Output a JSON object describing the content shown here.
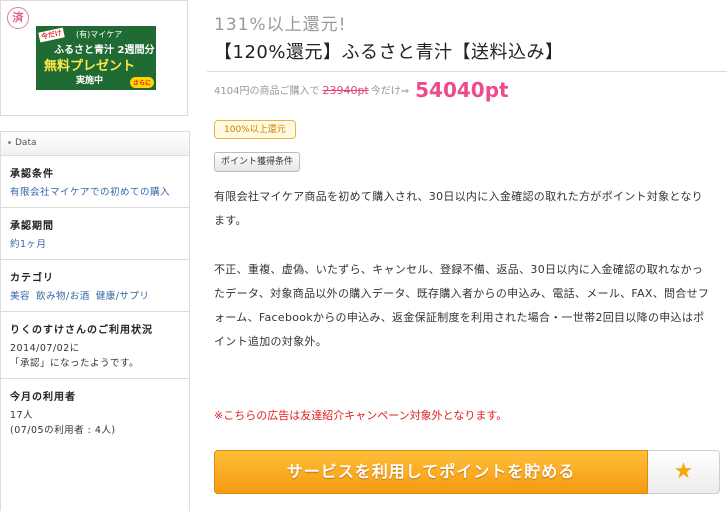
{
  "thumbnail": {
    "done_badge": "済",
    "banner": {
      "tag": "今だけ",
      "line1": "(有)マイケア",
      "line2": "ふるさと青汁 2週間分",
      "line3": "無料プレゼント",
      "line4": "実施中",
      "line5": "さらに"
    }
  },
  "data_panel": {
    "header": "Data",
    "approval_condition": {
      "title": "承認条件",
      "text": "有限会社マイケアでの初めての購入"
    },
    "approval_period": {
      "title": "承認期間",
      "text": "約1ヶ月"
    },
    "category": {
      "title": "カテゴリ",
      "links": [
        "美容",
        "飲み物/お酒",
        "健康/サプリ"
      ]
    },
    "usage_status": {
      "title": "りくのすけさんのご利用状況",
      "line1": "2014/07/02に",
      "line2": "「承認」になったようです。"
    },
    "today_users": {
      "title": "今月の利用者",
      "line1": "17人",
      "line2": "(07/05の利用者 : 4人)"
    }
  },
  "main": {
    "subtitle": "131%以上還元!",
    "title": "【120%還元】ふるさと青汁【送料込み】",
    "price": {
      "prefix": "4104円の商品ご購入で",
      "original_points": "23940pt",
      "middle": "今だけ⇒",
      "points": "54040pt"
    },
    "rate_badge": "100%以上還元",
    "condition_button": "ポイント獲得条件",
    "description_1": "有限会社マイケア商品を初めて購入され、30日以内に入金確認の取れた方がポイント対象となります。",
    "description_2": "不正、重複、虚偽、いたずら、キャンセル、登録不備、返品、30日以内に入金確認の取れなかったデータ、対象商品以外の購入データ、既存購入者からの申込み、電話、メール、FAX、問合せフォーム、Facebookからの申込み、返金保証制度を利用された場合・一世帯2回目以降の申込はポイント追加の対象外。",
    "notice": "※こちらの広告は友達紹介キャンペーン対象外となります。",
    "cta_button": "サービスを利用してポイントを貯める",
    "favorite_icon": "star-icon"
  },
  "colors": {
    "accent_pink": "#ec4b8d",
    "cta_orange": "#f59a10",
    "link_blue": "#3366aa",
    "notice_red": "#e02020"
  }
}
